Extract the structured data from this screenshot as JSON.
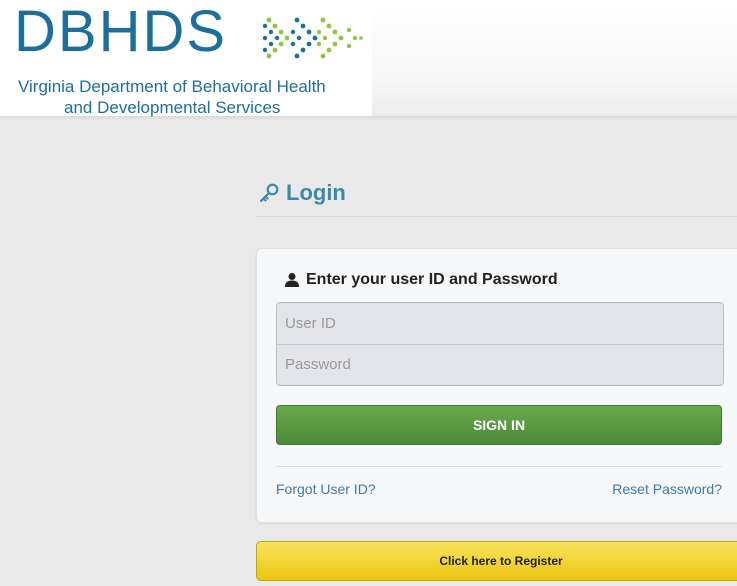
{
  "header": {
    "logo_word": "DBHDS",
    "logo_sub_line1": "Virginia Department of Behavioral Health",
    "logo_sub_line2": "and Developmental Services",
    "colors": {
      "logo_blue": "#1c6f9c",
      "logo_green": "#8dc63f"
    }
  },
  "login": {
    "title": "Login",
    "title_icon": "key-icon",
    "heading": "Enter your user ID and Password",
    "heading_icon": "user-icon",
    "user_id_placeholder": "User ID",
    "user_id_value": "",
    "password_placeholder": "Password",
    "password_value": "",
    "sign_in_label": "SIGN IN",
    "forgot_user_id": "Forgot User ID?",
    "reset_password": "Reset Password?",
    "register_label": "Click here to Register",
    "colors": {
      "title": "#3d8aa6",
      "sign_in": "#4c8a38",
      "link": "#3f79a8",
      "register": "#ecc512"
    }
  }
}
